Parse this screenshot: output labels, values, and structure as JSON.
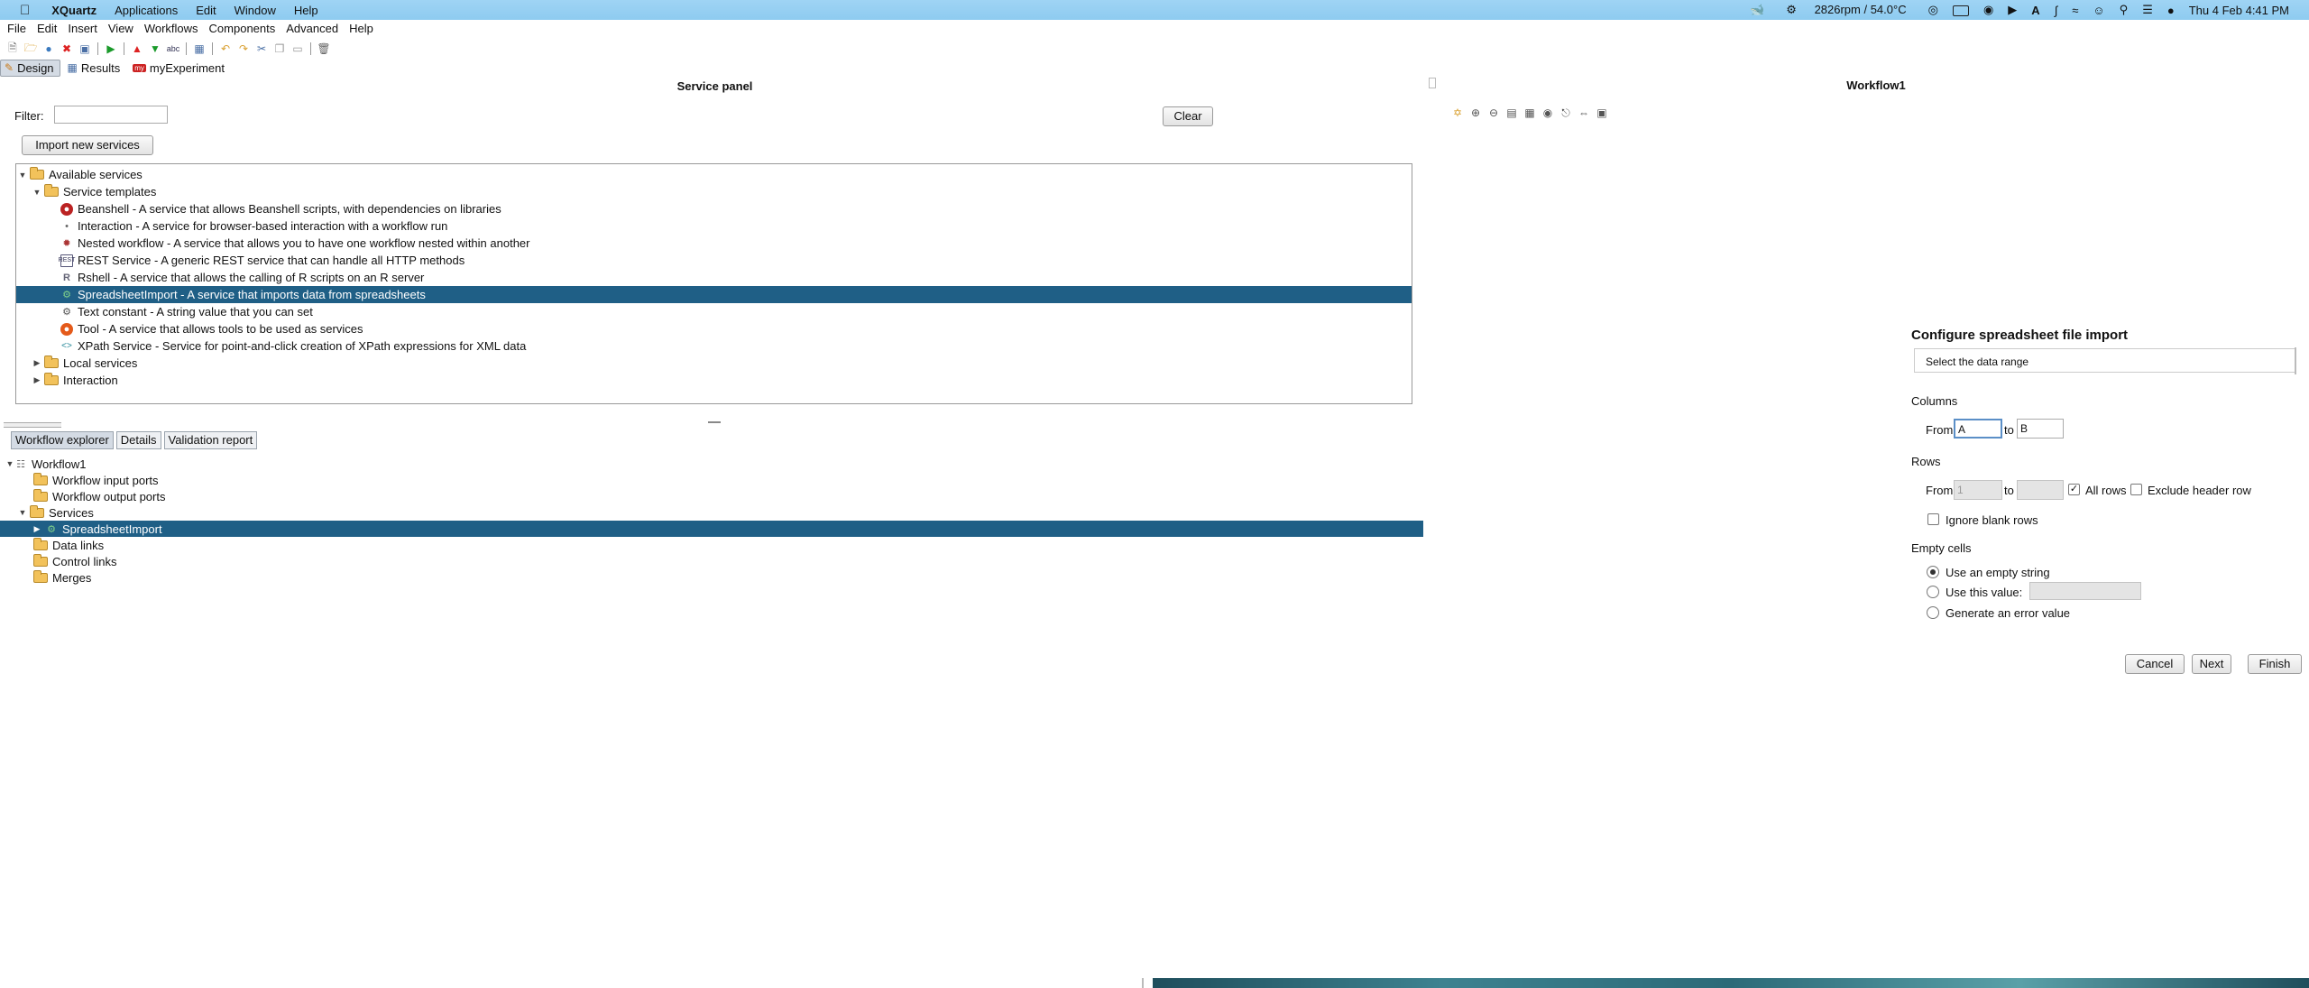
{
  "macbar": {
    "app_name": "XQuartz",
    "menus": [
      "Applications",
      "Edit",
      "Window",
      "Help"
    ],
    "status_text": "2826rpm / 54.0°C",
    "clock": "Thu 4 Feb  4:41 PM"
  },
  "app_menu": [
    "File",
    "Edit",
    "Insert",
    "View",
    "Workflows",
    "Components",
    "Advanced",
    "Help"
  ],
  "perspectives": [
    {
      "label": "Design",
      "active": true
    },
    {
      "label": "Results",
      "active": false
    },
    {
      "label": "myExperiment",
      "active": false
    }
  ],
  "service_panel": {
    "title": "Service panel",
    "filter_label": "Filter:",
    "filter_value": "",
    "clear_label": "Clear",
    "import_label": "Import new services",
    "tree": {
      "root": "Available services",
      "templates_folder": "Service templates",
      "templates": [
        "Beanshell - A service that allows Beanshell scripts, with dependencies on libraries",
        "Interaction - A service for browser-based interaction with a workflow run",
        "Nested workflow - A service that allows you to have one workflow nested within another",
        "REST Service - A generic REST service that can handle all HTTP methods",
        "Rshell - A service that allows the calling of R scripts on an R server",
        "SpreadsheetImport - A service that imports data from spreadsheets",
        "Text constant - A string value that you can set",
        "Tool - A service that allows tools to be used as services",
        "XPath Service - Service for point-and-click creation of XPath expressions for XML data"
      ],
      "selected_index": 5,
      "local_folder": "Local services",
      "interaction_folder": "Interaction"
    }
  },
  "explorer": {
    "tabs": [
      "Workflow explorer",
      "Details",
      "Validation report"
    ],
    "active_tab": 0,
    "workflow": "Workflow1",
    "input_ports": "Workflow input ports",
    "output_ports": "Workflow output ports",
    "services": "Services",
    "service_item": "SpreadsheetImport",
    "data_links": "Data links",
    "control_links": "Control links",
    "merges": "Merges"
  },
  "workflow_pane": {
    "title": "Workflow1"
  },
  "dialog": {
    "title": "Configure spreadsheet file import",
    "subtitle": "Select the data range",
    "columns_label": "Columns",
    "from_label": "From",
    "to_label": "to",
    "col_from": "A",
    "col_to": "B",
    "rows_label": "Rows",
    "row_from_placeholder": "1",
    "row_to": "",
    "all_rows_label": "All rows",
    "all_rows_checked": true,
    "exclude_header_label": "Exclude header row",
    "exclude_header_checked": false,
    "ignore_blank_label": "Ignore blank rows",
    "ignore_blank_checked": false,
    "empty_cells_label": "Empty cells",
    "empty_options": [
      "Use an empty string",
      "Use this value:",
      "Generate an error value"
    ],
    "empty_selected": 0,
    "use_value": "",
    "buttons": {
      "cancel": "Cancel",
      "next": "Next",
      "finish": "Finish"
    }
  }
}
